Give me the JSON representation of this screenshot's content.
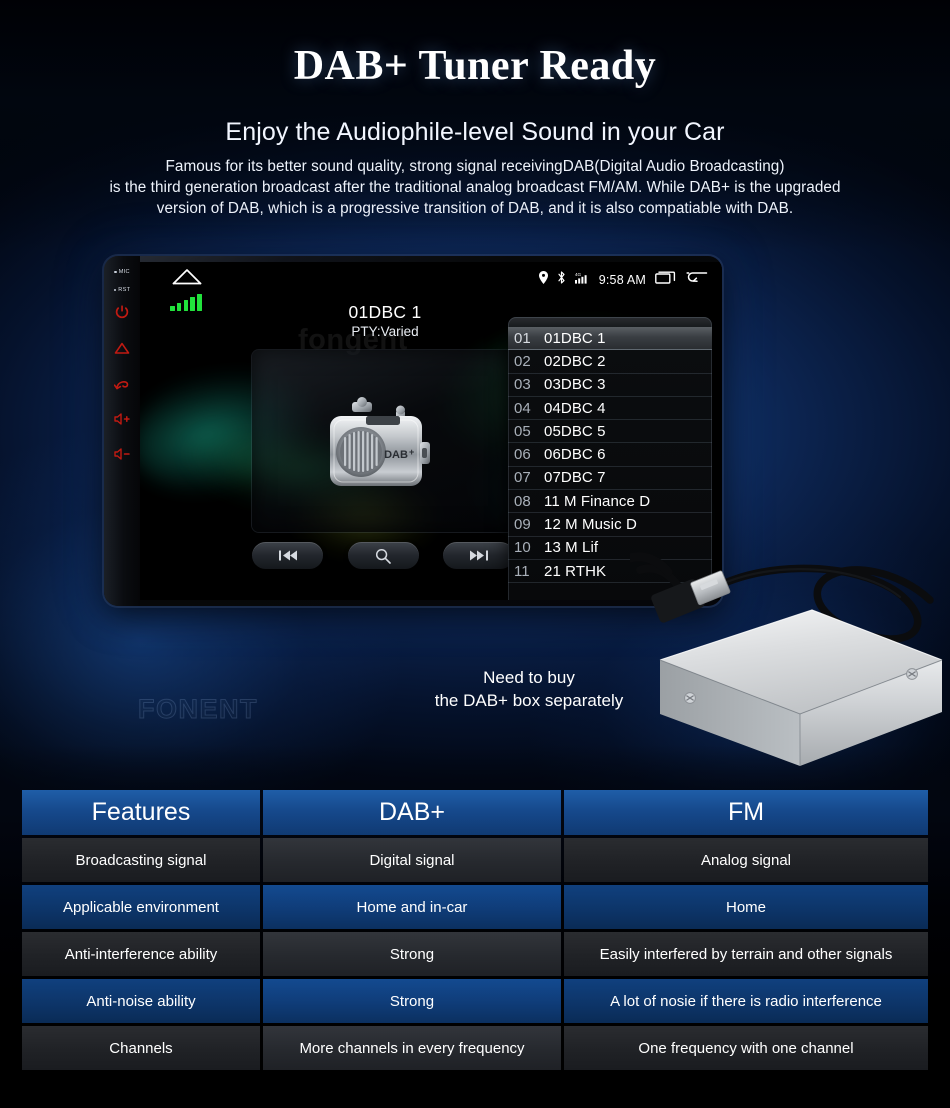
{
  "header": {
    "headline": "DAB+ Tuner Ready",
    "subhead": "Enjoy the Audiophile-level Sound in your Car",
    "body_line1": "Famous for its better sound quality, strong signal receivingDAB(Digital Audio Broadcasting)",
    "body_line2": "is the third generation broadcast after the traditional analog broadcast FM/AM. While DAB+ is the upgraded",
    "body_line3": "version of DAB, which is a progressive transition of DAB, and it is also compatiable with DAB."
  },
  "head_unit": {
    "rail": {
      "mic_label": "MIC",
      "rst_label": "RST",
      "buttons": [
        "power-icon",
        "home-icon",
        "back-icon",
        "volume-up-icon",
        "volume-down-icon"
      ]
    },
    "status_bar": {
      "home_icon": "home-outline-icon",
      "signal_bars": 5,
      "location_icon": "location-pin-icon",
      "bluetooth_icon": "bluetooth-icon",
      "network_icon": "4g-signal-icon",
      "network_label": "4G",
      "time": "9:58 AM",
      "recents_icon": "recents-icon",
      "back_icon": "back-arrow-icon"
    },
    "now_playing": {
      "station": "01DBC 1",
      "pty": "PTY:Varied",
      "artwork_label": "DAB+"
    },
    "controls": [
      {
        "name": "previous-button",
        "icon": "previous-track-icon"
      },
      {
        "name": "search-button",
        "icon": "search-icon"
      },
      {
        "name": "next-button",
        "icon": "next-track-icon"
      }
    ],
    "watermark": "fongent",
    "station_list": [
      {
        "index": "01",
        "name": "01DBC 1",
        "selected": true
      },
      {
        "index": "02",
        "name": "02DBC 2",
        "selected": false
      },
      {
        "index": "03",
        "name": "03DBC 3",
        "selected": false
      },
      {
        "index": "04",
        "name": "04DBC 4",
        "selected": false
      },
      {
        "index": "05",
        "name": "05DBC 5",
        "selected": false
      },
      {
        "index": "06",
        "name": "06DBC 6",
        "selected": false
      },
      {
        "index": "07",
        "name": "07DBC 7",
        "selected": false
      },
      {
        "index": "08",
        "name": "11 M Finance D",
        "selected": false
      },
      {
        "index": "09",
        "name": "12 M Music D",
        "selected": false
      },
      {
        "index": "10",
        "name": "13 M Lif",
        "selected": false
      },
      {
        "index": "11",
        "name": "21 RTHK",
        "selected": false
      }
    ]
  },
  "callout": {
    "line1": "Need to buy",
    "line2": "the DAB+ box separately"
  },
  "watermark_bottom": "FONENT",
  "table": {
    "headers": [
      "Features",
      "DAB+",
      "FM"
    ],
    "rows": [
      [
        "Broadcasting signal",
        "Digital signal",
        "Analog signal"
      ],
      [
        "Applicable environment",
        "Home and in-car",
        "Home"
      ],
      [
        "Anti-interference ability",
        "Strong",
        "Easily interfered by terrain and other signals"
      ],
      [
        "Anti-noise ability",
        "Strong",
        "A lot of nosie if there is radio interference"
      ],
      [
        "Channels",
        "More channels in every frequency",
        "One frequency with one channel"
      ]
    ]
  },
  "colors": {
    "accent_blue": "#16498c",
    "row_blue": "#0d3569",
    "row_dark": "#202226",
    "signal_green": "#21e33c",
    "rail_red": "#c01a12"
  }
}
